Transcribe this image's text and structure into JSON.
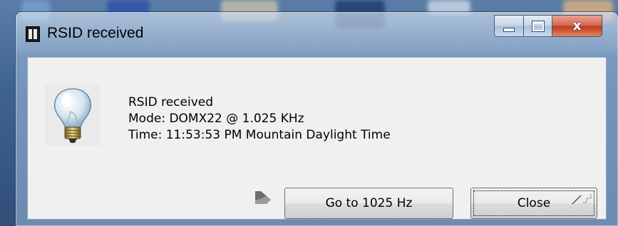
{
  "window": {
    "title": "RSID received",
    "caption_buttons": {
      "minimize": "minimize",
      "maximize": "maximize",
      "close_glyph": "x"
    }
  },
  "message": {
    "line1": "RSID received",
    "line2": "Mode: DOMX22 @ 1.025 KHz",
    "line3": "Time:  11:53:53 PM Mountain Daylight Time"
  },
  "buttons": {
    "goto_label": "Go to 1025 Hz",
    "close_label": "Close"
  },
  "icons": {
    "app": "app-icon",
    "info": "lightbulb-icon",
    "pointer": "cursor-icon",
    "grip": "resize-grip-icon"
  },
  "colors": {
    "client_background": "#f0f0f0",
    "close_caption": "#c2381c",
    "glass_frame": "#a0bedc"
  }
}
